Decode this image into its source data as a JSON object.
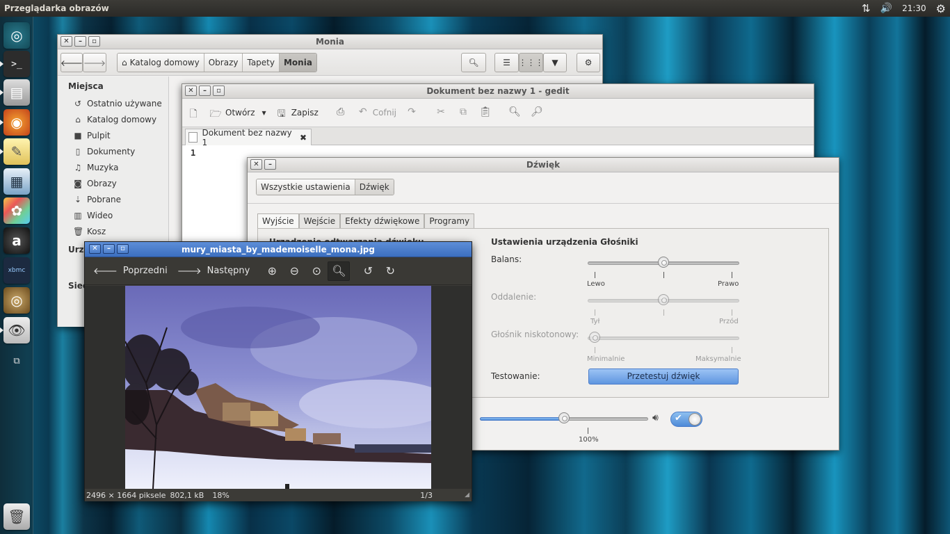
{
  "topbar": {
    "app_title": "Przeglądarka obrazów",
    "clock": "21:30"
  },
  "launcher": {
    "icons": [
      "ubuntu-dash-icon",
      "terminal-icon",
      "file-manager-icon",
      "firefox-icon",
      "text-editor-icon",
      "writer-icon",
      "paint-icon",
      "audio-player-icon",
      "xbmc-icon",
      "speaker-icon",
      "image-viewer-icon",
      "workspace-icon",
      "trash-icon"
    ],
    "xbmc_label": "xbmc"
  },
  "files": {
    "title": "Monia",
    "breadcrumb": [
      "Katalog domowy",
      "Obrazy",
      "Tapety",
      "Monia"
    ],
    "sidebar_section_places": "Miejsca",
    "sidebar_items": [
      "Ostatnio używane",
      "Katalog domowy",
      "Pulpit",
      "Dokumenty",
      "Muzyka",
      "Obrazy",
      "Pobrane",
      "Wideo",
      "Kosz"
    ],
    "sidebar_section_devices": "Urzą",
    "sidebar_section_network": "Sieć"
  },
  "gedit": {
    "title": "Dokument bez nazwy 1 - gedit",
    "open_label": "Otwórz",
    "save_label": "Zapisz",
    "undo_label": "Cofnij",
    "doc_tab": "Dokument bez nazwy 1",
    "line_number": "1"
  },
  "sound": {
    "title": "Dźwięk",
    "crumb_all": "Wszystkie ustawienia",
    "crumb_sound": "Dźwięk",
    "tabs": [
      "Wyjście",
      "Wejście",
      "Efekty dźwiękowe",
      "Programy"
    ],
    "device_heading": "Urządzenie odtwarzania dźwięku",
    "settings_heading": "Ustawienia urządzenia Głośniki",
    "balance_label": "Balans:",
    "balance_left": "Lewo",
    "balance_right": "Prawo",
    "balance_value": 0.5,
    "fade_label": "Oddalenie:",
    "fade_back": "Tył",
    "fade_front": "Przód",
    "fade_value": 0.5,
    "subwoofer_label": "Głośnik niskotonowy:",
    "sub_min": "Minimalnie",
    "sub_max": "Maksymalnie",
    "subwoofer_value": 0.0,
    "test_label": "Testowanie:",
    "test_button": "Przetestuj dźwięk",
    "volume_value": 0.5,
    "volume_percent": "100%"
  },
  "viewer": {
    "title": "mury_miasta_by_mademoiselle_mona.jpg",
    "prev_label": "Poprzedni",
    "next_label": "Następny",
    "status_size": "2496 × 1664 piksele",
    "status_filesize": "802,1 kB",
    "status_zoom": "18%",
    "status_index": "1/3"
  }
}
